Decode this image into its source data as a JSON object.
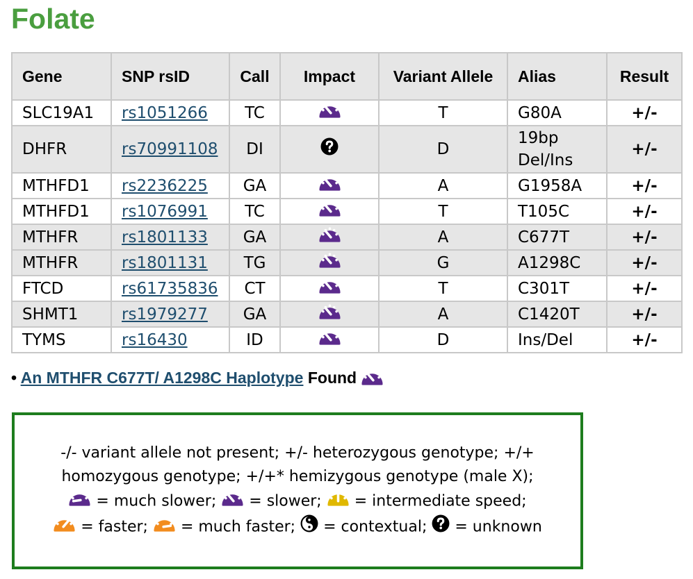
{
  "title": "Folate",
  "table": {
    "headers": {
      "gene": "Gene",
      "snp": "SNP rsID",
      "call": "Call",
      "impact": "Impact",
      "variant": "Variant Allele",
      "alias": "Alias",
      "result": "Result"
    },
    "rows": [
      {
        "gene": "SLC19A1",
        "rsid": "rs1051266",
        "call": "TC",
        "impact": "slower",
        "variant": "T",
        "alias": "G80A",
        "result": "+/-",
        "shaded": false
      },
      {
        "gene": "DHFR",
        "rsid": "rs70991108",
        "call": "DI",
        "impact": "unknown",
        "variant": "D",
        "alias": "19bp Del/Ins",
        "result": "+/-",
        "shaded": true
      },
      {
        "gene": "MTHFD1",
        "rsid": "rs2236225",
        "call": "GA",
        "impact": "slower",
        "variant": "A",
        "alias": "G1958A",
        "result": "+/-",
        "shaded": false
      },
      {
        "gene": "MTHFD1",
        "rsid": "rs1076991",
        "call": "TC",
        "impact": "slower",
        "variant": "T",
        "alias": "T105C",
        "result": "+/-",
        "shaded": false
      },
      {
        "gene": "MTHFR",
        "rsid": "rs1801133",
        "call": "GA",
        "impact": "slower",
        "variant": "A",
        "alias": "C677T",
        "result": "+/-",
        "shaded": true
      },
      {
        "gene": "MTHFR",
        "rsid": "rs1801131",
        "call": "TG",
        "impact": "slower",
        "variant": "G",
        "alias": "A1298C",
        "result": "+/-",
        "shaded": true
      },
      {
        "gene": "FTCD",
        "rsid": "rs61735836",
        "call": "CT",
        "impact": "slower",
        "variant": "T",
        "alias": "C301T",
        "result": "+/-",
        "shaded": false
      },
      {
        "gene": "SHMT1",
        "rsid": "rs1979277",
        "call": "GA",
        "impact": "slower",
        "variant": "A",
        "alias": "C1420T",
        "result": "+/-",
        "shaded": true
      },
      {
        "gene": "TYMS",
        "rsid": "rs16430",
        "call": "ID",
        "impact": "slower",
        "variant": "D",
        "alias": "Ins/Del",
        "result": "+/-",
        "shaded": false
      }
    ]
  },
  "haplotype": {
    "bullet": "•",
    "link_text": "An MTHFR C677T/ A1298C Haplotype",
    "suffix": "Found",
    "impact": "slower"
  },
  "legend": {
    "line1": "-/- variant allele not present; +/- heterozygous genotype; +/+",
    "line2": "homozygous genotype; +/+* hemizygous genotype (male X);",
    "items": [
      {
        "icon": "much-slower",
        "label": "= much slower;"
      },
      {
        "icon": "slower",
        "label": "= slower;"
      },
      {
        "icon": "intermediate",
        "label": "= intermediate speed;"
      },
      {
        "icon": "faster",
        "label": "= faster;"
      },
      {
        "icon": "much-faster",
        "label": "= much faster;"
      },
      {
        "icon": "contextual",
        "label": "= contextual;"
      },
      {
        "icon": "unknown",
        "label": "= unknown"
      }
    ]
  },
  "colors": {
    "title": "#4a9e3f",
    "link": "#1f4e6e",
    "slower": "#5b2a8c",
    "intermediate": "#e0b800",
    "faster": "#f28c1e",
    "legend_border": "#1e7d1e",
    "header_bg": "#e6e6e6"
  }
}
